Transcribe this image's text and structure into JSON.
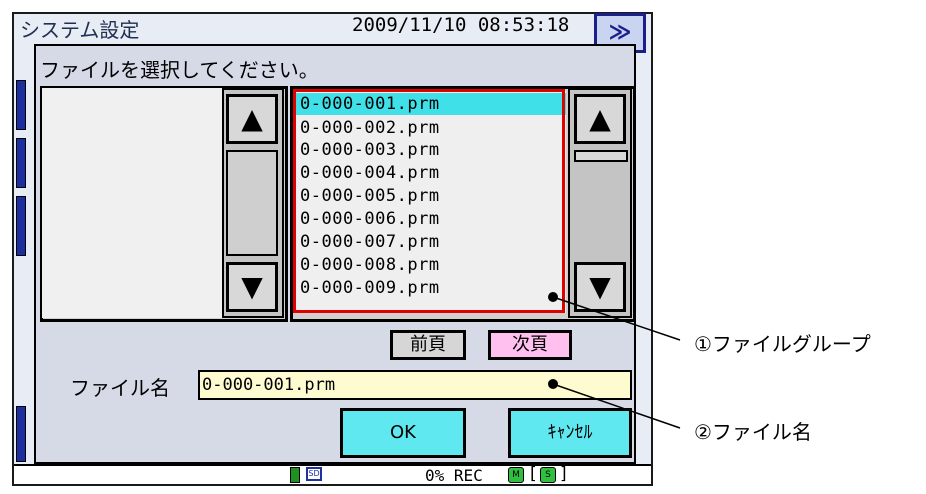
{
  "background": {
    "title": "システム設定",
    "datetime": "2009/11/10 08:53:18",
    "nav_button": "≫"
  },
  "dialog": {
    "title": "ファイルを選択してください。",
    "files": [
      "0-000-001.prm",
      "0-000-002.prm",
      "0-000-003.prm",
      "0-000-004.prm",
      "0-000-005.prm",
      "0-000-006.prm",
      "0-000-007.prm",
      "0-000-008.prm",
      "0-000-009.prm"
    ],
    "selected_file": "0-000-001.prm",
    "scroll_up": "▲",
    "scroll_down": "▼",
    "prev_page": "前頁",
    "next_page": "次頁",
    "filename_label": "ファイル名",
    "filename_value": "0-000-001.prm",
    "ok": "OK",
    "cancel": "ｷｬﾝｾﾙ"
  },
  "statusbar": {
    "sd_label": "SD",
    "text": "0% REC",
    "bracket_left": "[",
    "bracket_right": "]",
    "m_label": "M",
    "s_label": "S"
  },
  "callouts": {
    "file_group": "①ファイルグループ",
    "file_name": "②ファイル名"
  },
  "colors": {
    "selection": "#40e0e8",
    "dialog_bg": "#d6dae6",
    "input_bg": "#fffbd0",
    "next_page_bg": "#ffc0f0",
    "highlight_frame": "#e00000",
    "action_button": "#60e8f0"
  }
}
